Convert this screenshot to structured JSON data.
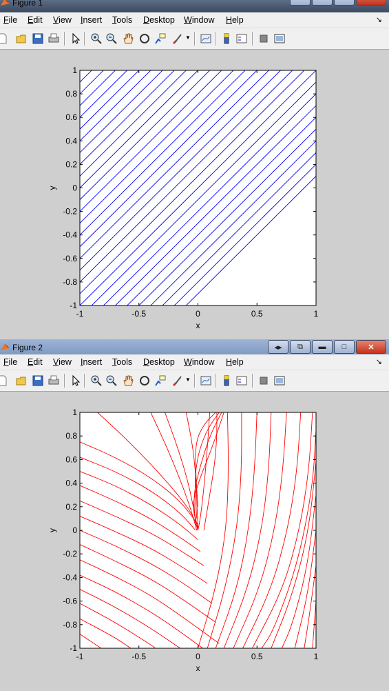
{
  "figure1": {
    "title": "Figure 1",
    "line_color": "#0000ff"
  },
  "figure2": {
    "title": "Figure 2",
    "line_color": "#ff0000"
  },
  "menu": {
    "items": [
      {
        "first": "F",
        "rest": "ile"
      },
      {
        "first": "E",
        "rest": "dit"
      },
      {
        "first": "V",
        "rest": "iew"
      },
      {
        "first": "I",
        "rest": "nsert"
      },
      {
        "first": "T",
        "rest": "ools"
      },
      {
        "first": "D",
        "rest": "esktop"
      },
      {
        "first": "W",
        "rest": "indow"
      },
      {
        "first": "H",
        "rest": "elp"
      }
    ],
    "dock_icon": "dock-arrow-icon"
  },
  "toolbar_icons": [
    "new-figure-icon",
    "open-file-icon",
    "save-icon",
    "print-icon",
    "pointer-icon",
    "zoom-in-icon",
    "zoom-out-icon",
    "pan-icon",
    "rotate-3d-icon",
    "data-cursor-icon",
    "brush-icon",
    "link-plot-icon",
    "colorbar-icon",
    "legend-icon",
    "hide-plot-tools-icon",
    "show-plot-tools-icon"
  ],
  "window_controls": [
    "restore-dock-icon",
    "undock-icon",
    "minimize-icon",
    "maximize-icon",
    "close-icon"
  ],
  "chart_data": [
    {
      "type": "line",
      "title": "",
      "xlabel": "x",
      "ylabel": "y",
      "xlim": [
        -1,
        1
      ],
      "ylim": [
        -1,
        1
      ],
      "xticks": [
        "-1",
        "-0.5",
        "0",
        "0.5",
        "1"
      ],
      "yticks": [
        "-1",
        "-0.8",
        "-0.6",
        "-0.4",
        "-0.2",
        "0",
        "0.2",
        "0.4",
        "0.6",
        "0.8",
        "1"
      ],
      "grid": false,
      "description_lines": "parallel lines y = x + c",
      "series": [
        {
          "c": -0.9
        },
        {
          "c": -0.8
        },
        {
          "c": -0.7
        },
        {
          "c": -0.6
        },
        {
          "c": -0.5
        },
        {
          "c": -0.4
        },
        {
          "c": -0.3
        },
        {
          "c": -0.2
        },
        {
          "c": -0.1
        },
        {
          "c": 0.0
        },
        {
          "c": 0.1
        },
        {
          "c": 0.2
        },
        {
          "c": 0.3
        },
        {
          "c": 0.4
        },
        {
          "c": 0.5
        },
        {
          "c": 0.6
        },
        {
          "c": 0.7
        },
        {
          "c": 0.8
        },
        {
          "c": 0.9
        },
        {
          "c": 1.0
        },
        {
          "c": 1.1
        },
        {
          "c": 1.2
        },
        {
          "c": 1.3
        },
        {
          "c": 1.4
        },
        {
          "c": 1.5
        },
        {
          "c": 1.6
        },
        {
          "c": 1.7
        },
        {
          "c": 1.8
        },
        {
          "c": 1.9
        }
      ]
    },
    {
      "type": "line",
      "title": "",
      "xlabel": "x",
      "ylabel": "y",
      "xlim": [
        -1,
        1
      ],
      "ylim": [
        -1,
        1
      ],
      "xticks": [
        "-1",
        "-0.5",
        "0",
        "0.5",
        "1"
      ],
      "yticks": [
        "-1",
        "-0.8",
        "-0.6",
        "-0.4",
        "-0.2",
        "0",
        "0.2",
        "0.4",
        "0.6",
        "0.8",
        "1"
      ],
      "grid": false,
      "series": [
        {
          "points": [
            [
              -0.85,
              1.0
            ],
            [
              -0.55,
              0.72
            ],
            [
              -0.25,
              0.4
            ],
            [
              -0.05,
              0.15
            ],
            [
              0.0,
              0.0
            ]
          ]
        },
        {
          "points": [
            [
              -1.0,
              0.75
            ],
            [
              -0.7,
              0.62
            ],
            [
              -0.4,
              0.45
            ],
            [
              -0.15,
              0.25
            ],
            [
              0.0,
              0.05
            ]
          ]
        },
        {
          "points": [
            [
              -1.0,
              0.62
            ],
            [
              -0.7,
              0.5
            ],
            [
              -0.4,
              0.34
            ],
            [
              -0.15,
              0.15
            ],
            [
              -0.02,
              0.0
            ]
          ]
        },
        {
          "points": [
            [
              -1.0,
              0.5
            ],
            [
              -0.7,
              0.38
            ],
            [
              -0.4,
              0.22
            ],
            [
              -0.15,
              0.05
            ],
            [
              0.0,
              -0.08
            ]
          ]
        },
        {
          "points": [
            [
              -1.0,
              0.38
            ],
            [
              -0.7,
              0.25
            ],
            [
              -0.4,
              0.1
            ],
            [
              -0.15,
              -0.06
            ],
            [
              0.02,
              -0.18
            ]
          ]
        },
        {
          "points": [
            [
              -1.0,
              0.25
            ],
            [
              -0.7,
              0.12
            ],
            [
              -0.4,
              -0.02
            ],
            [
              -0.15,
              -0.17
            ],
            [
              0.05,
              -0.3
            ]
          ]
        },
        {
          "points": [
            [
              -1.0,
              0.12
            ],
            [
              -0.7,
              -0.01
            ],
            [
              -0.4,
              -0.15
            ],
            [
              -0.15,
              -0.3
            ],
            [
              0.08,
              -0.45
            ]
          ]
        },
        {
          "points": [
            [
              -1.0,
              0.0
            ],
            [
              -0.7,
              -0.13
            ],
            [
              -0.4,
              -0.28
            ],
            [
              -0.15,
              -0.43
            ],
            [
              0.12,
              -0.62
            ]
          ]
        },
        {
          "points": [
            [
              -1.0,
              -0.12
            ],
            [
              -0.7,
              -0.26
            ],
            [
              -0.4,
              -0.41
            ],
            [
              -0.15,
              -0.57
            ],
            [
              0.15,
              -0.78
            ]
          ]
        },
        {
          "points": [
            [
              -1.0,
              -0.25
            ],
            [
              -0.7,
              -0.39
            ],
            [
              -0.4,
              -0.55
            ],
            [
              -0.15,
              -0.72
            ],
            [
              0.18,
              -0.96
            ]
          ]
        },
        {
          "points": [
            [
              -1.0,
              -0.38
            ],
            [
              -0.7,
              -0.52
            ],
            [
              -0.4,
              -0.69
            ],
            [
              -0.15,
              -0.86
            ],
            [
              0.04,
              -1.0
            ]
          ]
        },
        {
          "points": [
            [
              -1.0,
              -0.5
            ],
            [
              -0.7,
              -0.65
            ],
            [
              -0.4,
              -0.83
            ],
            [
              -0.15,
              -1.0
            ]
          ]
        },
        {
          "points": [
            [
              -1.0,
              -0.62
            ],
            [
              -0.7,
              -0.78
            ],
            [
              -0.4,
              -0.97
            ],
            [
              -0.36,
              -1.0
            ]
          ]
        },
        {
          "points": [
            [
              -1.0,
              -0.75
            ],
            [
              -0.7,
              -0.91
            ],
            [
              -0.57,
              -1.0
            ]
          ]
        },
        {
          "points": [
            [
              -1.0,
              -0.88
            ],
            [
              -0.82,
              -1.0
            ]
          ]
        },
        {
          "points": [
            [
              0.25,
              1.0
            ],
            [
              0.26,
              0.5
            ],
            [
              0.24,
              0.0
            ],
            [
              0.15,
              -0.5
            ],
            [
              0.0,
              -1.0
            ]
          ]
        },
        {
          "points": [
            [
              0.37,
              1.0
            ],
            [
              0.37,
              0.5
            ],
            [
              0.33,
              0.0
            ],
            [
              0.23,
              -0.5
            ],
            [
              0.08,
              -1.0
            ]
          ]
        },
        {
          "points": [
            [
              0.5,
              1.0
            ],
            [
              0.48,
              0.5
            ],
            [
              0.43,
              0.0
            ],
            [
              0.33,
              -0.5
            ],
            [
              0.15,
              -1.0
            ]
          ]
        },
        {
          "points": [
            [
              0.62,
              1.0
            ],
            [
              0.6,
              0.5
            ],
            [
              0.54,
              0.0
            ],
            [
              0.42,
              -0.5
            ],
            [
              0.22,
              -1.0
            ]
          ]
        },
        {
          "points": [
            [
              0.75,
              1.0
            ],
            [
              0.72,
              0.5
            ],
            [
              0.65,
              0.0
            ],
            [
              0.52,
              -0.5
            ],
            [
              0.3,
              -1.0
            ]
          ]
        },
        {
          "points": [
            [
              0.87,
              1.0
            ],
            [
              0.84,
              0.5
            ],
            [
              0.76,
              0.0
            ],
            [
              0.62,
              -0.5
            ],
            [
              0.38,
              -1.0
            ]
          ]
        },
        {
          "points": [
            [
              0.97,
              1.0
            ],
            [
              0.94,
              0.5
            ],
            [
              0.86,
              0.0
            ],
            [
              0.72,
              -0.5
            ],
            [
              0.46,
              -1.0
            ]
          ]
        },
        {
          "points": [
            [
              1.0,
              0.85
            ],
            [
              0.97,
              0.35
            ],
            [
              0.84,
              -0.3
            ],
            [
              0.64,
              -0.85
            ],
            [
              0.54,
              -1.0
            ]
          ]
        },
        {
          "points": [
            [
              1.0,
              0.58
            ],
            [
              0.94,
              0.0
            ],
            [
              0.8,
              -0.55
            ],
            [
              0.62,
              -1.0
            ]
          ]
        },
        {
          "points": [
            [
              1.0,
              0.3
            ],
            [
              0.93,
              -0.3
            ],
            [
              0.8,
              -0.8
            ],
            [
              0.71,
              -1.0
            ]
          ]
        },
        {
          "points": [
            [
              1.0,
              0.0
            ],
            [
              0.93,
              -0.55
            ],
            [
              0.82,
              -1.0
            ]
          ]
        },
        {
          "points": [
            [
              1.0,
              -0.3
            ],
            [
              0.94,
              -0.75
            ],
            [
              0.9,
              -1.0
            ]
          ]
        },
        {
          "points": [
            [
              1.0,
              -0.6
            ],
            [
              0.97,
              -1.0
            ]
          ]
        },
        {
          "points": [
            [
              0.22,
              1.0
            ],
            [
              0.12,
              0.7
            ],
            [
              0.0,
              0.4
            ],
            [
              -0.05,
              0.2
            ],
            [
              0.0,
              0.02
            ]
          ]
        },
        {
          "points": [
            [
              0.2,
              1.0
            ],
            [
              0.1,
              0.8
            ],
            [
              0.02,
              0.55
            ],
            [
              -0.04,
              0.3
            ],
            [
              -0.02,
              0.05
            ]
          ]
        },
        {
          "points": [
            [
              0.18,
              1.0
            ],
            [
              0.08,
              0.86
            ],
            [
              0.0,
              0.65
            ],
            [
              -0.03,
              0.4
            ],
            [
              -0.01,
              0.1
            ]
          ]
        },
        {
          "points": [
            [
              0.15,
              1.0
            ],
            [
              0.05,
              0.9
            ],
            [
              -0.02,
              0.75
            ],
            [
              -0.02,
              0.5
            ],
            [
              0.0,
              0.2
            ]
          ]
        },
        {
          "points": [
            [
              -0.1,
              1.0
            ],
            [
              -0.05,
              0.75
            ],
            [
              -0.02,
              0.5
            ],
            [
              -0.01,
              0.25
            ],
            [
              0.0,
              0.02
            ]
          ]
        },
        {
          "points": [
            [
              -0.28,
              1.0
            ],
            [
              -0.17,
              0.7
            ],
            [
              -0.08,
              0.4
            ],
            [
              -0.03,
              0.15
            ],
            [
              0.0,
              0.0
            ]
          ]
        },
        {
          "points": [
            [
              -0.4,
              1.0
            ],
            [
              -0.27,
              0.72
            ],
            [
              -0.15,
              0.43
            ],
            [
              -0.06,
              0.18
            ],
            [
              -0.01,
              0.0
            ]
          ]
        },
        {
          "points": [
            [
              0.1,
              1.0
            ],
            [
              0.08,
              0.7
            ],
            [
              0.05,
              0.35
            ],
            [
              0.02,
              0.1
            ],
            [
              0.0,
              0.0
            ]
          ]
        },
        {
          "points": [
            [
              0.16,
              1.0
            ],
            [
              0.16,
              0.78
            ],
            [
              0.14,
              0.55
            ],
            [
              0.1,
              0.3
            ],
            [
              0.05,
              0.0
            ]
          ]
        }
      ]
    }
  ]
}
